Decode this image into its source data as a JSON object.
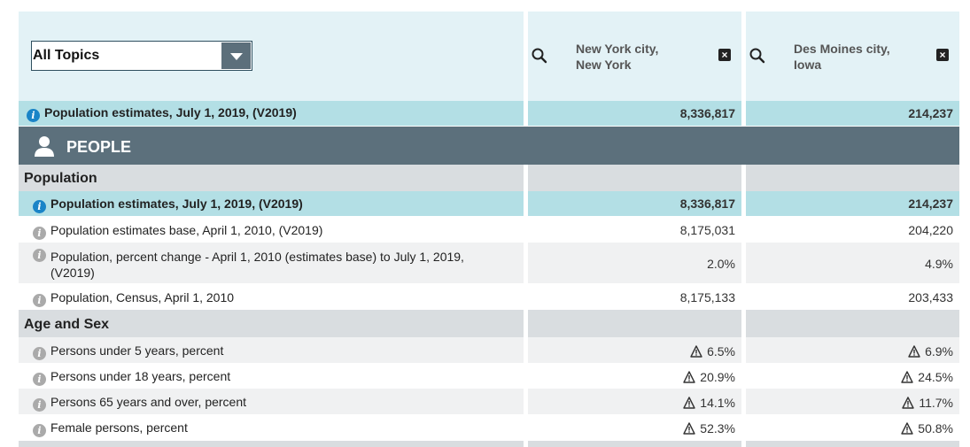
{
  "topics_select": {
    "value": "All Topics"
  },
  "geographies": [
    {
      "name": "New York city, New York",
      "line1": "New York city,",
      "line2": "New York"
    },
    {
      "name": "Des Moines city, Iowa",
      "line1": "Des Moines city,",
      "line2": "Iowa"
    }
  ],
  "summary_row": {
    "label": "Population estimates, July 1, 2019, (V2019)",
    "values": [
      "8,336,817",
      "214,237"
    ]
  },
  "people_header": "PEOPLE",
  "sections": [
    {
      "title": "Population",
      "rows": [
        {
          "label": "Population estimates, July 1, 2019, (V2019)",
          "values": [
            "8,336,817",
            "214,237"
          ]
        },
        {
          "label": "Population estimates base, April 1, 2010, (V2019)",
          "values": [
            "8,175,031",
            "204,220"
          ]
        },
        {
          "label_line1": "Population, percent change - April 1, 2010 (estimates base) to July 1, 2019,",
          "label_line2": "(V2019)",
          "values": [
            "2.0%",
            "4.9%"
          ]
        },
        {
          "label": "Population, Census, April 1, 2010",
          "values": [
            "8,175,133",
            "203,433"
          ]
        }
      ]
    },
    {
      "title": "Age and Sex",
      "rows": [
        {
          "label": "Persons under 5 years, percent",
          "values": [
            "6.5%",
            "6.9%"
          ]
        },
        {
          "label": "Persons under 18 years, percent",
          "values": [
            "20.9%",
            "24.5%"
          ]
        },
        {
          "label": "Persons 65 years and over, percent",
          "values": [
            "14.1%",
            "11.7%"
          ]
        },
        {
          "label": "Female persons, percent",
          "values": [
            "52.3%",
            "50.8%"
          ]
        }
      ]
    }
  ],
  "colors": {
    "teal_row": "#b3dfe5",
    "header_bg": "#e3f2f6",
    "people_bar": "#5c707c",
    "section_grey": "#d9dde0",
    "info_blue": "#1a84c7"
  },
  "icons": [
    "search-icon",
    "close-icon",
    "info-icon",
    "person-icon",
    "warning-icon",
    "chevron-down-icon"
  ]
}
